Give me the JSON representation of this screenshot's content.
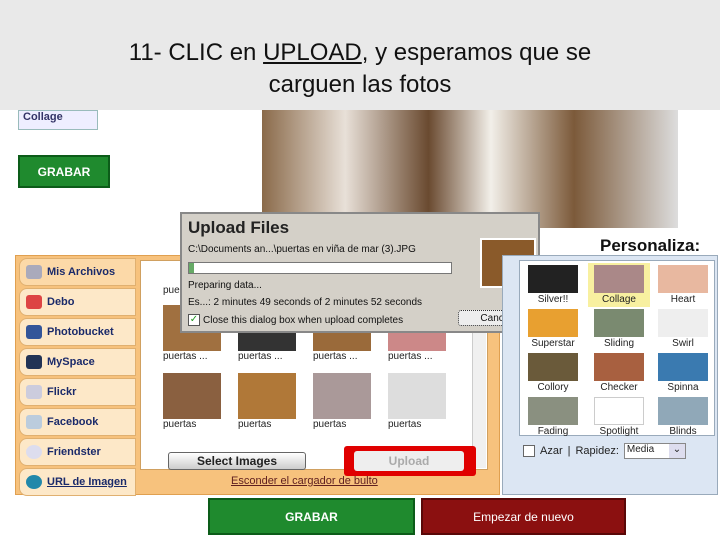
{
  "banner": {
    "pre": "11- CLIC en ",
    "emph": "UPLOAD",
    "post": ", y esperamos que se",
    "line2": "carguen las fotos"
  },
  "logo": "Collage",
  "grabar_top": "GRABAR",
  "tabs": [
    "Mis Archivos",
    "Debo",
    "Photobucket",
    "MySpace",
    "Flickr",
    "Facebook",
    "Friendster",
    "URL de Imagen"
  ],
  "grid_labels": [
    "pue",
    "puertas ...",
    "puertas ...",
    "puertas ...",
    "puertas ...",
    "puertas",
    "puertas",
    "puertas",
    "puertas"
  ],
  "select_images": "Select Images",
  "upload": "Upload",
  "hide_link": "Esconder el cargador de bulto",
  "dialog": {
    "title": "Upload Files",
    "file": "C:\\Documents an...\\puertas en viña de mar (3).JPG",
    "progress": 2,
    "status": "Preparing data...",
    "eta": "Es...: 2 minutes 49 seconds of 2 minutes 52 seconds",
    "close_label": "Close this dialog box when upload completes",
    "close_checked": true,
    "cancel": "Cancel"
  },
  "personaliza": "Personaliza:",
  "effects": [
    "Silver!!",
    "Collage",
    "Heart",
    "Superstar",
    "Sliding",
    "Swirl",
    "Collory",
    "Checker",
    "Spinna",
    "Fading",
    "Spotlight",
    "Blinds"
  ],
  "selected_effect": "Collage",
  "azar": "Azar",
  "sep": "|",
  "rapidez_label": "Rapidez:",
  "rapidez_value": "Media",
  "grabar_bottom": "GRABAR",
  "empezar": "Empezar de nuevo",
  "colors": {
    "green": "#1f8a2e",
    "red": "#8b1010",
    "highlight": "#e00000",
    "panel": "#f7c27d"
  }
}
